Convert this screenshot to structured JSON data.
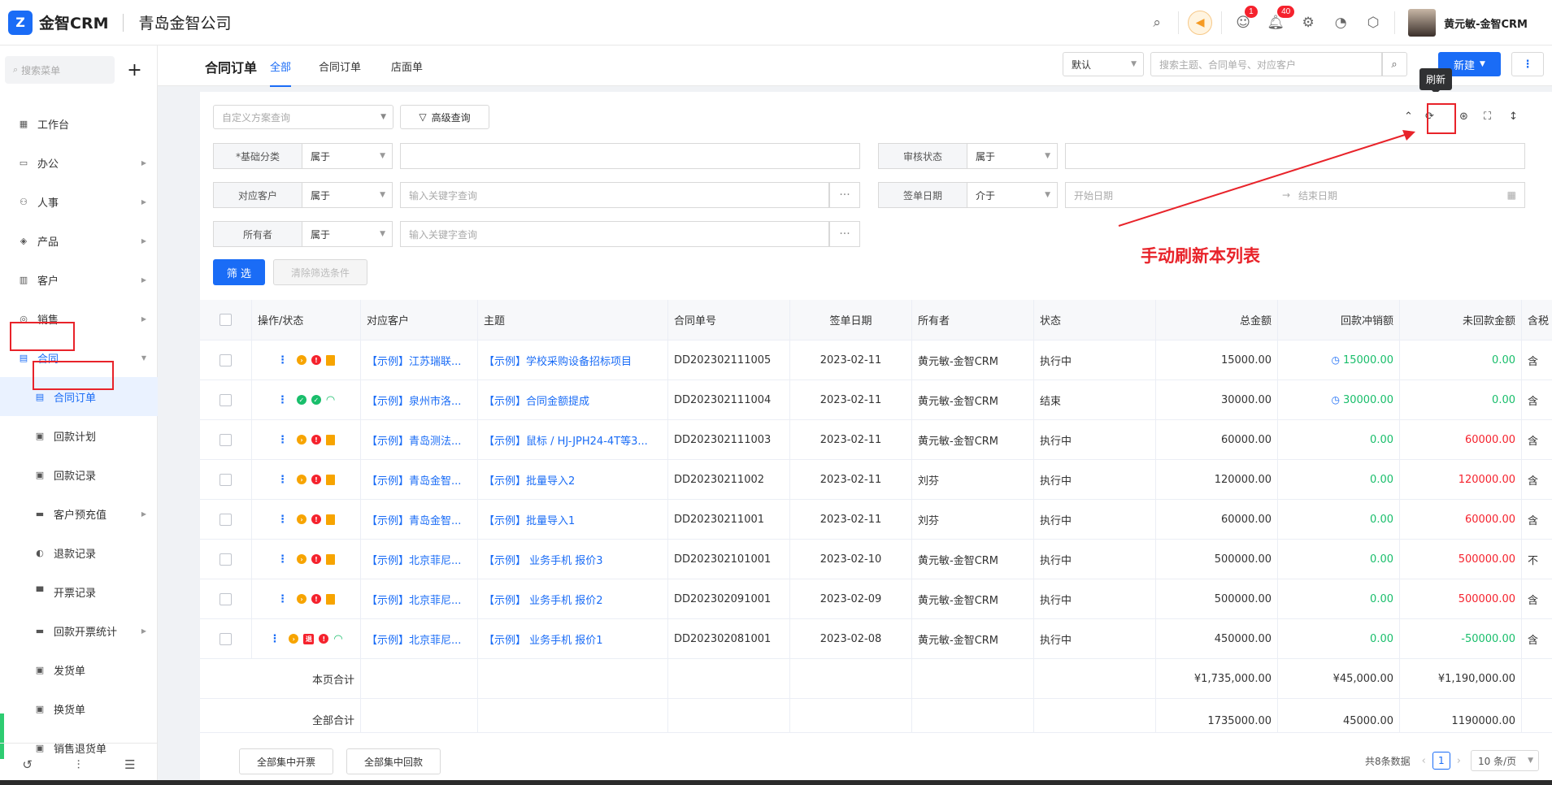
{
  "topbar": {
    "logo_glyph": "Z",
    "app_name": "金智CRM",
    "company": "青岛金智公司",
    "badges": {
      "contacts": "1",
      "notifications": "40"
    },
    "user_name": "黄元敏-金智CRM"
  },
  "sidebar": {
    "search_placeholder": "搜索菜单",
    "add_label": "+",
    "items": [
      {
        "label": "工作台",
        "icon": "dashboard-icon"
      },
      {
        "label": "办公",
        "icon": "office-icon"
      },
      {
        "label": "人事",
        "icon": "hr-icon"
      },
      {
        "label": "产品",
        "icon": "product-icon"
      },
      {
        "label": "客户",
        "icon": "customer-icon"
      },
      {
        "label": "销售",
        "icon": "sales-icon"
      },
      {
        "label": "合同",
        "icon": "contract-icon"
      },
      {
        "label": "合同订单",
        "icon": "order-icon"
      },
      {
        "label": "回款计划",
        "icon": "plan-icon"
      },
      {
        "label": "回款记录",
        "icon": "record-icon"
      },
      {
        "label": "客户预充值",
        "icon": "prepaid-icon"
      },
      {
        "label": "退款记录",
        "icon": "refund-icon"
      },
      {
        "label": "开票记录",
        "icon": "invoice-icon"
      },
      {
        "label": "回款开票统计",
        "icon": "stats-icon"
      },
      {
        "label": "发货单",
        "icon": "delivery-icon"
      },
      {
        "label": "换货单",
        "icon": "exchange-icon"
      },
      {
        "label": "销售退货单",
        "icon": "return-icon"
      }
    ]
  },
  "header": {
    "title": "合同订单",
    "tabs": [
      "全部",
      "合同订单",
      "店面单"
    ],
    "view_select": "默认",
    "search_placeholder": "搜索主题、合同单号、对应客户",
    "new_label": "新建",
    "more_label": "⋮",
    "tooltip": "刷新"
  },
  "filters": {
    "plan_placeholder": "自定义方案查询",
    "advanced_label": "高级查询",
    "rows": [
      {
        "label": "*基础分类",
        "op": "属于",
        "value": ""
      },
      {
        "label": "审核状态",
        "op": "属于",
        "value": ""
      },
      {
        "label": "对应客户",
        "op": "属于",
        "value": "输入关键字查询"
      },
      {
        "label": "签单日期",
        "op": "介于",
        "start": "开始日期",
        "sep": "→",
        "end": "结束日期"
      },
      {
        "label": "所有者",
        "op": "属于",
        "value": "输入关键字查询"
      }
    ],
    "apply_label": "筛 选",
    "clear_label": "清除筛选条件"
  },
  "annotation": "手动刷新本列表",
  "table": {
    "columns": [
      "操作/状态",
      "对应客户",
      "主题",
      "合同单号",
      "签单日期",
      "所有者",
      "状态",
      "总金额",
      "回款冲销额",
      "未回款金额",
      "含税"
    ],
    "rows": [
      {
        "icons": [
          "o",
          "r",
          "doc"
        ],
        "customer": "【示例】江苏瑞联...",
        "subject": "【示例】学校采购设备招标项目",
        "no": "DD202302111005",
        "date": "2023-02-11",
        "owner": "黄元敏-金智CRM",
        "status": "执行中",
        "total": "15000.00",
        "paid": "15000.00",
        "paid_clock": true,
        "unpaid": "0.00",
        "unpaid_color": "green",
        "tax": "含"
      },
      {
        "icons": [
          "g",
          "g",
          "q"
        ],
        "customer": "【示例】泉州市洛...",
        "subject": "【示例】合同金额提成",
        "no": "DD202302111004",
        "date": "2023-02-11",
        "owner": "黄元敏-金智CRM",
        "status": "结束",
        "total": "30000.00",
        "paid": "30000.00",
        "paid_clock": true,
        "unpaid": "0.00",
        "unpaid_color": "green",
        "tax": "含"
      },
      {
        "icons": [
          "o",
          "r",
          "doc"
        ],
        "customer": "【示例】青岛测法...",
        "subject": "【示例】鼠标 / HJ-JPH24-4T等3...",
        "no": "DD202302111003",
        "date": "2023-02-11",
        "owner": "黄元敏-金智CRM",
        "status": "执行中",
        "total": "60000.00",
        "paid": "0.00",
        "paid_clock": false,
        "unpaid": "60000.00",
        "unpaid_color": "red",
        "tax": "含"
      },
      {
        "icons": [
          "o",
          "r",
          "doc"
        ],
        "customer": "【示例】青岛金智...",
        "subject": "【示例】批量导入2",
        "no": "DD20230211002",
        "date": "2023-02-11",
        "owner": "刘芬",
        "status": "执行中",
        "total": "120000.00",
        "paid": "0.00",
        "paid_clock": false,
        "unpaid": "120000.00",
        "unpaid_color": "red",
        "tax": "含"
      },
      {
        "icons": [
          "o",
          "r",
          "doc"
        ],
        "customer": "【示例】青岛金智...",
        "subject": "【示例】批量导入1",
        "no": "DD20230211001",
        "date": "2023-02-11",
        "owner": "刘芬",
        "status": "执行中",
        "total": "60000.00",
        "paid": "0.00",
        "paid_clock": false,
        "unpaid": "60000.00",
        "unpaid_color": "red",
        "tax": "含"
      },
      {
        "icons": [
          "o",
          "r",
          "doc"
        ],
        "customer": "【示例】北京菲尼...",
        "subject": "【示例】 业务手机 报价3",
        "no": "DD202302101001",
        "date": "2023-02-10",
        "owner": "黄元敏-金智CRM",
        "status": "执行中",
        "total": "500000.00",
        "paid": "0.00",
        "paid_clock": false,
        "unpaid": "500000.00",
        "unpaid_color": "red",
        "tax": "不"
      },
      {
        "icons": [
          "o",
          "r",
          "doc"
        ],
        "customer": "【示例】北京菲尼...",
        "subject": "【示例】 业务手机 报价2",
        "no": "DD202302091001",
        "date": "2023-02-09",
        "owner": "黄元敏-金智CRM",
        "status": "执行中",
        "total": "500000.00",
        "paid": "0.00",
        "paid_clock": false,
        "unpaid": "500000.00",
        "unpaid_color": "red",
        "tax": "含"
      },
      {
        "icons": [
          "o",
          "back",
          "r",
          "q"
        ],
        "customer": "【示例】北京菲尼...",
        "subject": "【示例】 业务手机 报价1",
        "no": "DD202302081001",
        "date": "2023-02-08",
        "owner": "黄元敏-金智CRM",
        "status": "执行中",
        "total": "450000.00",
        "paid": "0.00",
        "paid_clock": false,
        "unpaid": "-50000.00",
        "unpaid_color": "green",
        "tax": "含"
      }
    ],
    "page_total": {
      "label": "本页合计",
      "total": "¥1,735,000.00",
      "paid": "¥45,000.00",
      "unpaid": "¥1,190,000.00"
    },
    "all_total": {
      "label": "全部合计",
      "total": "1735000.00",
      "paid": "45000.00",
      "unpaid": "1190000.00"
    }
  },
  "footer": {
    "batch_invoice": "全部集中开票",
    "batch_payment": "全部集中回款",
    "count_text": "共8条数据",
    "page": "1",
    "page_size": "10 条/页"
  },
  "colors": {
    "accent": "#1a6cf6",
    "annotation": "#e8232a",
    "positive": "#19be6b",
    "negative": "#f5222d"
  }
}
